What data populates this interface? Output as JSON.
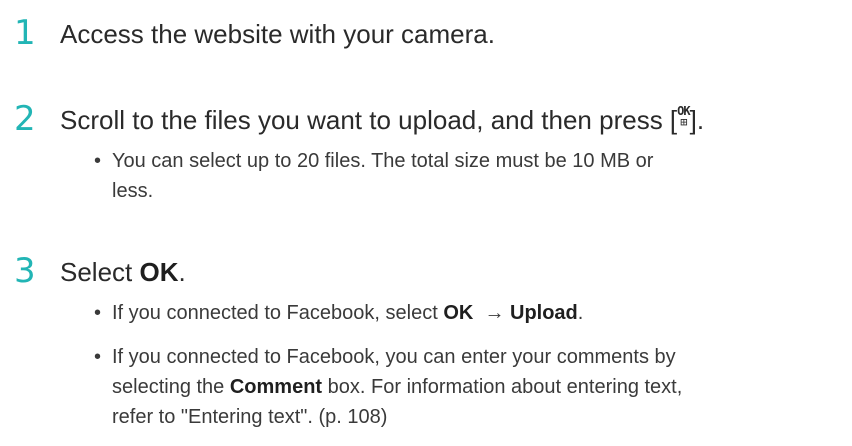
{
  "steps": [
    {
      "number": "1",
      "text": "Access the website with your camera."
    },
    {
      "number": "2",
      "text_before": "Scroll to the files you want to upload, and then press [",
      "ok_icon_top": "OK",
      "ok_icon_bottom": "⊞",
      "text_after": "].",
      "bullets": [
        {
          "line1": "You can select up to 20 files. The total size must be 10 MB or",
          "line2": "less."
        }
      ]
    },
    {
      "number": "3",
      "text_before": "Select ",
      "bold": "OK",
      "text_after": ".",
      "bullets": [
        {
          "before": "If you connected to Facebook, select ",
          "bold1": "OK",
          "arrow": "→",
          "bold2": "Upload",
          "after": "."
        },
        {
          "line1_before": "If you connected to Facebook, you can enter your comments by",
          "line2_before": "selecting the ",
          "line2_bold": "Comment",
          "line2_after": " box. For information about entering text,",
          "line3": "refer to \"Entering text\". (p. 108)"
        }
      ]
    }
  ],
  "bullet_symbol": "•",
  "colors": {
    "step_number": "#22b5b5",
    "text": "#2a2a2a"
  },
  "icons": {
    "ok_button": "ok-button-icon"
  }
}
